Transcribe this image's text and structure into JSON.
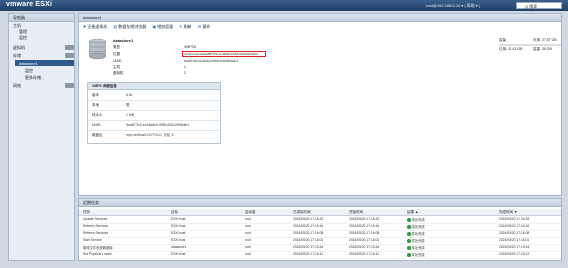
{
  "topbar": {
    "brand": "vmware ESXi",
    "info": "root@192.168.0.10 ▾ | 帮助 ▾ |",
    "search_placeholder": "Q 搜索"
  },
  "navigator": {
    "title": "导航器",
    "items": [
      {
        "label": "主机",
        "level": 0
      },
      {
        "label": "管理",
        "level": 1
      },
      {
        "label": "监控",
        "level": 1
      },
      {
        "label": "虚拟机",
        "level": 0,
        "badge": "0"
      },
      {
        "label": "存储",
        "level": 0,
        "badge": "1"
      },
      {
        "label": "datastore1",
        "level": 1,
        "selected": true
      },
      {
        "label": "监控",
        "level": 2
      },
      {
        "label": "更多存储...",
        "level": 2
      },
      {
        "label": "网络",
        "level": 0,
        "badge": "1"
      }
    ]
  },
  "main": {
    "title": "datastore1",
    "toolbar": [
      "注册虚拟机",
      "数据存储浏览器",
      "增加容量",
      "刷新",
      "操作"
    ],
    "details": {
      "name": "datastore1",
      "rows": [
        {
          "k": "类型",
          "v": "VMFS6"
        },
        {
          "k": "位置",
          "v": "/vmfs/volumes/5ad877b3-e1e8a5c0-0f55-000c29f3e8c1"
        },
        {
          "k": "UUID",
          "v": "5ad877b3-e1e8a5c0-0f55-000c29f3e8c1"
        },
        {
          "k": "主机",
          "v": "1"
        },
        {
          "k": "虚拟机",
          "v": "2"
        }
      ]
    },
    "resources": {
      "rows": [
        {
          "k": "容量",
          "v": "可用: 27.57 GB"
        },
        {
          "k": "已用: 11.43 GB",
          "v": "容量: 39 GB"
        }
      ]
    },
    "vmfs": {
      "title": "VMFS 详细信息",
      "rows": [
        {
          "k": "版本",
          "v": "6.81"
        },
        {
          "k": "本地",
          "v": "是"
        },
        {
          "k": "块大小",
          "v": "1 MB"
        },
        {
          "k": "UUID",
          "v": "5ad877b3-e1e8a5c0-0f55-000c29f3e8c1"
        },
        {
          "k": "磁盘区",
          "v": "mpx.vmhba0:C0:T0:L0, 分区 3"
        }
      ]
    }
  },
  "tasks": {
    "title": "近期任务",
    "columns": [
      "任务",
      "目标",
      "启动者",
      "已排队时间",
      "开始时间",
      "结果 ▲",
      "完成时间 ▼"
    ],
    "rows": [
      [
        "Update Services",
        "ESXi host",
        "root",
        "2024/05/20 17:16:32",
        "2024/05/20 17:16:32",
        "成功完成",
        "2024/05/20 17:16:33"
      ],
      [
        "Refresh Services",
        "ESXi host",
        "root",
        "2024/05/20 17:16:16",
        "2024/05/20 17:16:16",
        "成功完成",
        "2024/05/20 17:16:16"
      ],
      [
        "Refresh Services",
        "ESXi host",
        "root",
        "2024/05/20 17:16:08",
        "2024/05/20 17:16:08",
        "成功完成",
        "2024/05/20 17:16:08"
      ],
      [
        "Start Service",
        "ESXi host",
        "root",
        "2024/05/20 17:16:01",
        "2024/05/20 17:16:01",
        "成功完成",
        "2024/05/20 17:16:01"
      ],
      [
        "更改文件系统数据库",
        "datastore1",
        "root",
        "2024/05/20 17:15:44",
        "2024/05/20 17:15:44",
        "成功完成",
        "2024/05/20 17:15:44"
      ],
      [
        "Set Physical Locale",
        "ESXi host",
        "root",
        "2024/05/20 17:15:12",
        "2024/05/20 17:15:12",
        "成功完成",
        "2024/05/20 17:15:12"
      ]
    ]
  },
  "colors": {
    "accent": "#2f5b8f",
    "success": "#2f9e44",
    "highlight_border": "#dd2222"
  }
}
